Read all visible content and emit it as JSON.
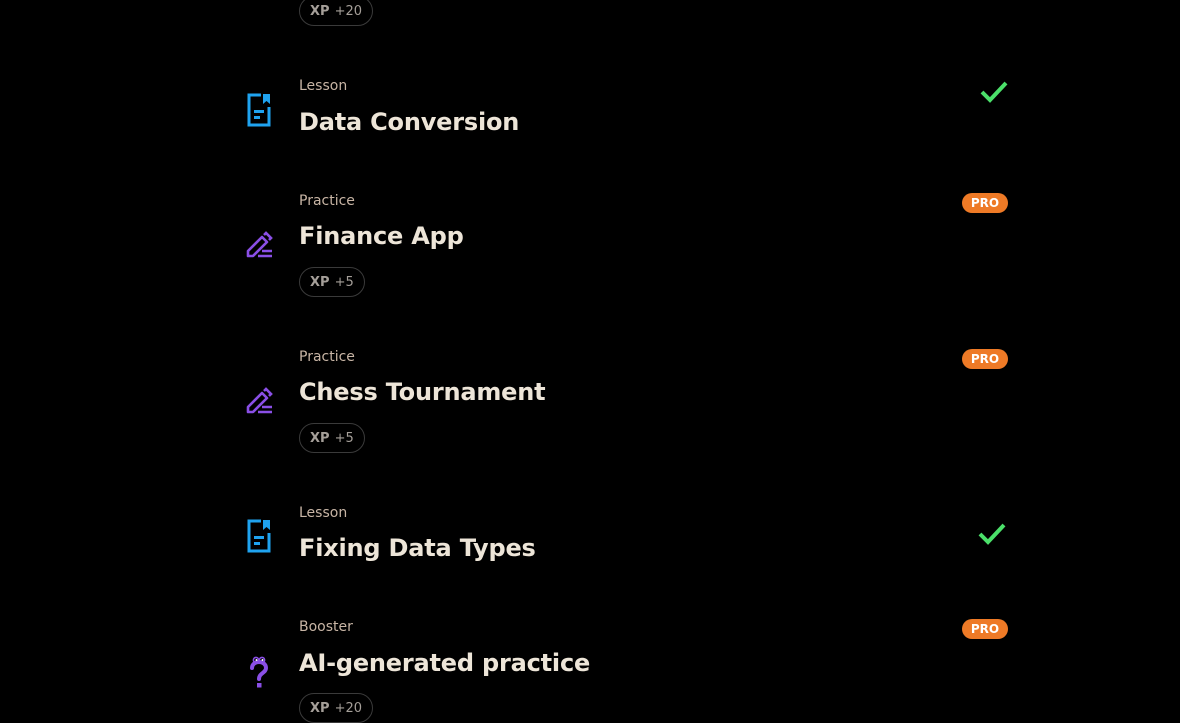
{
  "colors": {
    "background": "#000000",
    "lesson_icon": "#1fa3f0",
    "practice_icon": "#8a4fe6",
    "booster_icon": "#8a4fe6",
    "check": "#4be06a",
    "pro_badge": "#ee7a26"
  },
  "top_partial": {
    "xp_label": "XP",
    "xp_value": "+20"
  },
  "items": [
    {
      "kind": "Lesson",
      "title": "Data Conversion",
      "icon": "lesson-document-icon",
      "status": "completed"
    },
    {
      "kind": "Practice",
      "title": "Finance App",
      "icon": "practice-pencil-icon",
      "badge": "PRO",
      "xp_label": "XP",
      "xp_value": "+5"
    },
    {
      "kind": "Practice",
      "title": "Chess Tournament",
      "icon": "practice-pencil-icon",
      "badge": "PRO",
      "xp_label": "XP",
      "xp_value": "+5"
    },
    {
      "kind": "Lesson",
      "title": "Fixing Data Types",
      "icon": "lesson-document-icon",
      "status": "completed"
    },
    {
      "kind": "Booster",
      "title": "AI-generated practice",
      "icon": "booster-question-icon",
      "badge": "PRO",
      "xp_label": "XP",
      "xp_value": "+20"
    }
  ]
}
